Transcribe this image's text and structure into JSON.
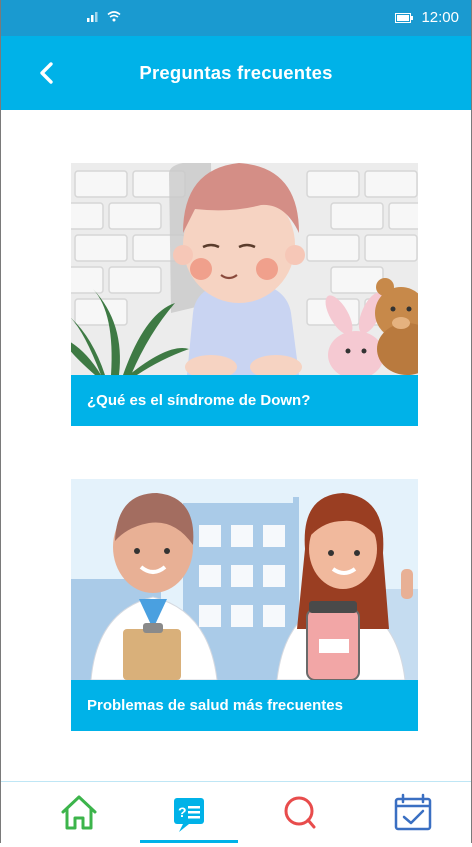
{
  "status_bar": {
    "time": "12:00"
  },
  "header": {
    "title": "Preguntas frecuentes",
    "back_icon": "chevron-left-icon"
  },
  "cards": [
    {
      "label": "¿Qué es el síndrome de Down?"
    },
    {
      "label": "Problemas de salud más frecuentes"
    }
  ],
  "bottom_nav": {
    "items": [
      {
        "icon": "home-icon",
        "active": false
      },
      {
        "icon": "faq-icon",
        "active": true
      },
      {
        "icon": "search-icon",
        "active": false
      },
      {
        "icon": "calendar-check-icon",
        "active": false
      }
    ]
  },
  "colors": {
    "primary": "#00b2e8",
    "status_bar": "#1a9ad0",
    "nav_home": "#3cb44b",
    "nav_faq": "#00b2e8",
    "nav_search": "#e84c4c",
    "nav_calendar": "#3a6fc2"
  }
}
